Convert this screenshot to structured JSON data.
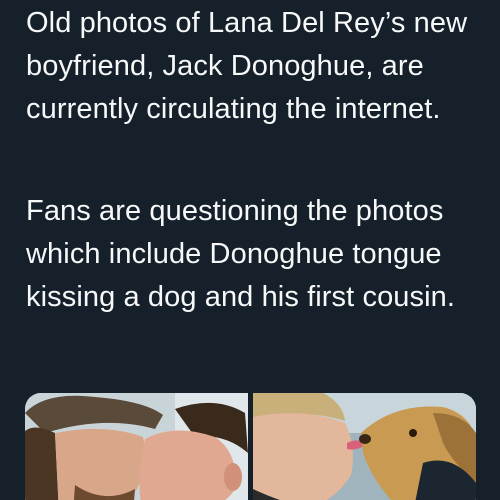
{
  "tweet": {
    "paragraphs": [
      "Old photos of Lana Del Rey’s new boyfriend, Jack Donoghue, are currently circulating the internet.",
      "Fans are questioning the photos which include Donoghue tongue kissing a dog and his first cousin."
    ],
    "media": [
      {
        "icon": "photo-two-men-kissing"
      },
      {
        "icon": "photo-man-kissing-dog"
      }
    ]
  },
  "colors": {
    "background": "#15202b",
    "text": "#f7f9f9"
  }
}
